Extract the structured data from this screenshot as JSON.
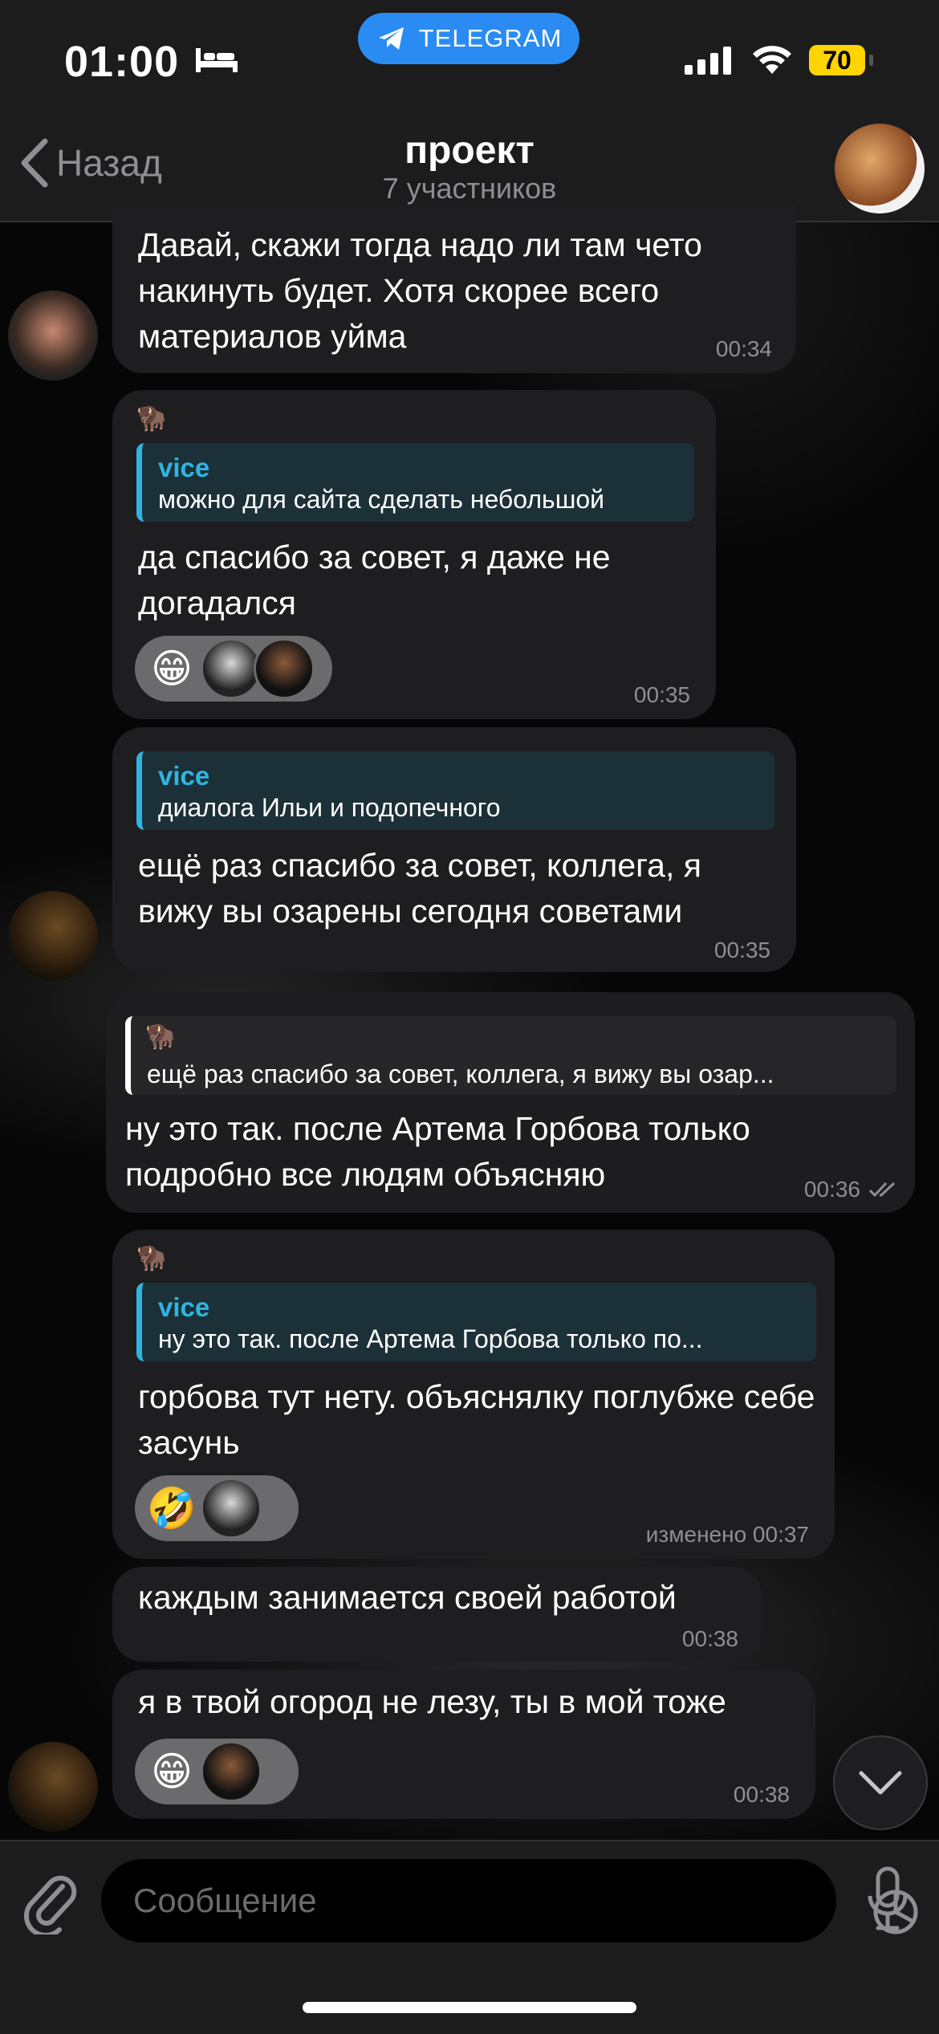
{
  "status_bar": {
    "time": "01:00",
    "sleep_icon": "bed-icon",
    "app_pill": "TELEGRAM",
    "battery": "70"
  },
  "header": {
    "back_label": "Назад",
    "title": "проект",
    "subtitle": "7 участников"
  },
  "messages": [
    {
      "text": "Давай, скажи тогда надо ли там чето накинуть будет. Хотя скорее всего материалов уйма",
      "time": "00:34"
    },
    {
      "reply_name": "vice",
      "reply_text": "можно для сайта сделать небольшой",
      "text": "да спасибо за совет, я даже не догадался",
      "reaction": "😁",
      "time": "00:35"
    },
    {
      "reply_name": "vice",
      "reply_text": "диалога Ильи и подопечного",
      "text": "ещё раз спасибо за совет, коллега, я вижу вы озарены сегодня советами",
      "time": "00:35"
    },
    {
      "reply_text": "ещё раз спасибо за совет, коллега, я вижу вы озар...",
      "text": "ну это так. после Артема Горбова только подробно все людям объясняю",
      "time": "00:36"
    },
    {
      "reply_name": "vice",
      "reply_text": "ну это так. после Артема Горбова только по...",
      "text": "горбова тут нету. объяснялку поглубже себе засунь",
      "reaction": "🤣",
      "time": "изменено 00:37"
    },
    {
      "text": "каждым занимается своей работой",
      "time": "00:38"
    },
    {
      "text": "я в твой огород не лезу, ты в мой тоже",
      "reaction": "😁",
      "time": "00:38"
    }
  ],
  "composer": {
    "placeholder": "Сообщение"
  },
  "colors": {
    "accent": "#2fb5e0",
    "telegram_blue": "#2a8bf2",
    "battery": "#ffd400",
    "bubble": "#1e1e20"
  }
}
